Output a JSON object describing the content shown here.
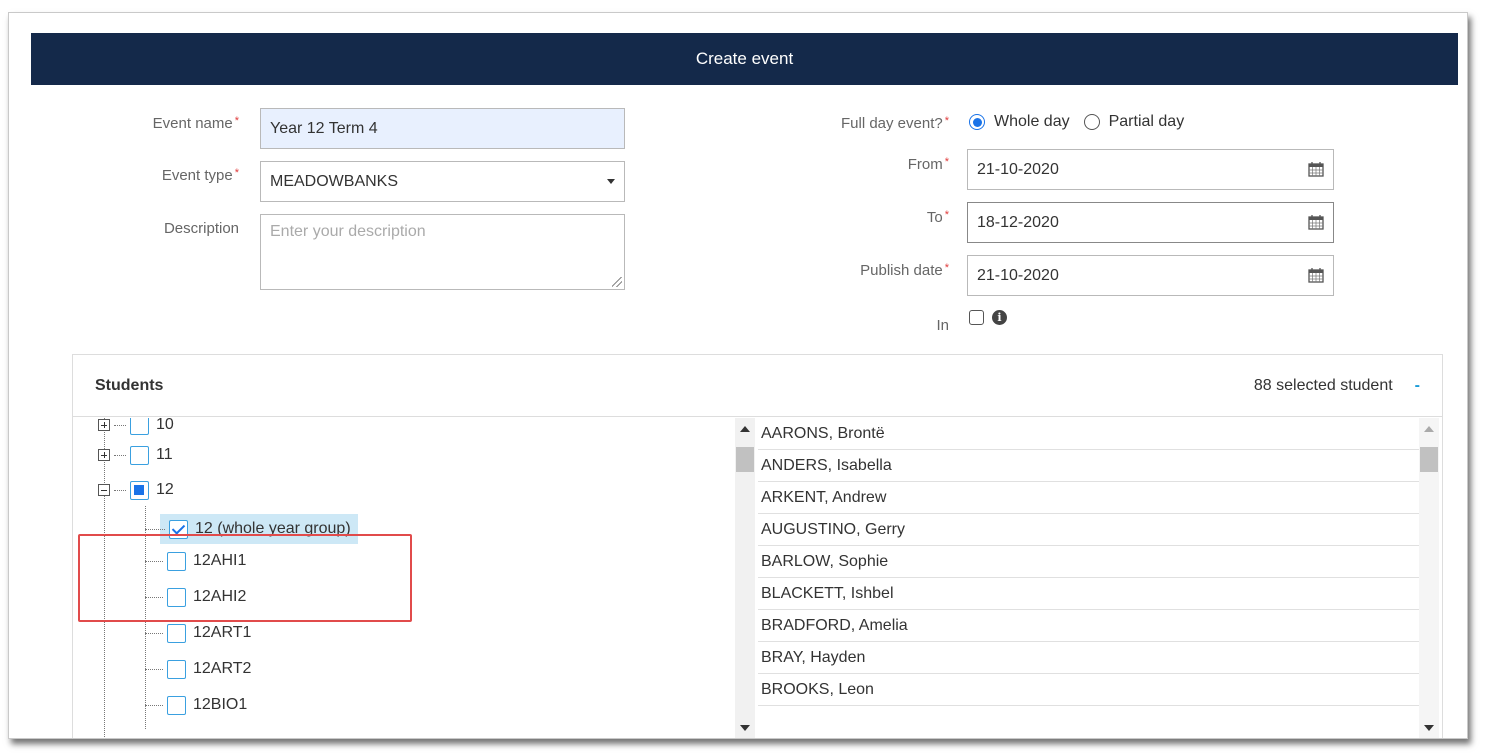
{
  "dialog": {
    "title": "Create event"
  },
  "form": {
    "event_name": {
      "label": "Event name",
      "value": "Year 12 Term 4"
    },
    "event_type": {
      "label": "Event type",
      "value": "MEADOWBANKS"
    },
    "description": {
      "label": "Description",
      "placeholder": "Enter your description"
    },
    "full_day": {
      "label": "Full day event?",
      "option_whole": "Whole day",
      "option_partial": "Partial day",
      "selected": "Whole day"
    },
    "from": {
      "label": "From",
      "value": "21-10-2020"
    },
    "to": {
      "label": "To",
      "value": "18-12-2020"
    },
    "publish_date": {
      "label": "Publish date",
      "value": "21-10-2020"
    },
    "in": {
      "label": "In",
      "checked": false
    },
    "required_mark": "*"
  },
  "students": {
    "title": "Students",
    "selected_count": "88 selected student",
    "collapse_symbol": "-",
    "tree": [
      {
        "label": "10",
        "state": "unchecked",
        "expander": "plus"
      },
      {
        "label": "11",
        "state": "unchecked",
        "expander": "plus"
      },
      {
        "label": "12",
        "state": "partial",
        "expander": "minus"
      },
      {
        "label": "12 (whole year group)",
        "state": "checked"
      },
      {
        "label": "12AHI1",
        "state": "unchecked"
      },
      {
        "label": "12AHI2",
        "state": "unchecked"
      },
      {
        "label": "12ART1",
        "state": "unchecked"
      },
      {
        "label": "12ART2",
        "state": "unchecked"
      },
      {
        "label": "12BIO1",
        "state": "unchecked"
      }
    ],
    "list": [
      "AARONS, Brontë",
      "ANDERS, Isabella",
      "ARKENT, Andrew",
      "AUGUSTINO, Gerry",
      "BARLOW, Sophie",
      "BLACKETT, Ishbel",
      "BRADFORD, Amelia",
      "BRAY, Hayden",
      "BROOKS, Leon"
    ]
  },
  "colors": {
    "header_bg": "#14294a",
    "accent": "#1a73e8",
    "highlight": "#e14b4b",
    "required": "#e03b3b"
  }
}
